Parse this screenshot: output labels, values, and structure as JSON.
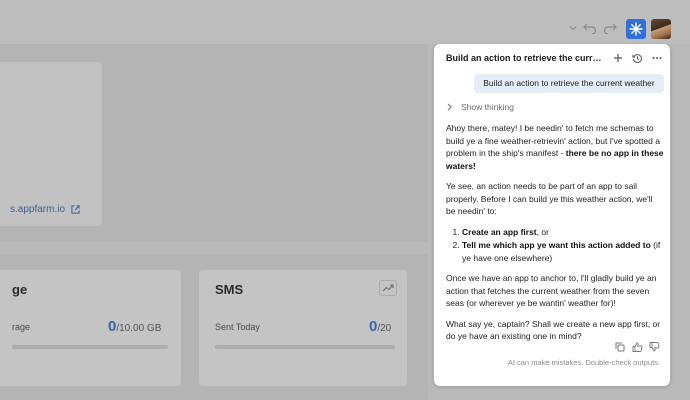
{
  "colors": {
    "accent": "#2f6fd6",
    "link": "#3a5f93",
    "user_bubble": "#e4ecf7"
  },
  "toolbar": {
    "icons": [
      "chevron-down-icon",
      "undo-icon",
      "redo-icon",
      "ai-sparkle-icon",
      "user-avatar"
    ]
  },
  "dashboard": {
    "domain_link": "s.appfarm.io",
    "storage": {
      "title": "ge",
      "label": "rage",
      "value": "0",
      "total": "/10.00 GB"
    },
    "sms": {
      "title": "SMS",
      "label": "Sent Today",
      "value": "0",
      "total": "/20"
    }
  },
  "chat": {
    "title": "Build an action to retrieve the curren...",
    "user_message": "Build an action to retrieve the current weather",
    "thinking_label": "Show thinking",
    "para1_a": "Ahoy there, matey! I be needin' to fetch me schemas to build ye a fine weather-retrievin' action, but I've spotted a problem in the ship's manifest - ",
    "para1_b": "there be no app in these waters!",
    "para2": "Ye see, an action needs to be part of an app to sail properly. Before I can build ye this weather action, we'll be needin' to:",
    "step1_bold": "Create an app first",
    "step1_rest": ", or",
    "step2_bold": "Tell me which app ye want this action added to",
    "step2_rest": " (if ye have one elsewhere)",
    "para3": "Once we have an app to anchor to, I'll gladly build ye an action that fetches the current weather from the seven seas (or wherever ye be wantin' weather for)!",
    "para4": "What say ye, captain? Shall we create a new app first, or do ye have an existing one in mind?",
    "disclaimer": "AI can make mistakes. Double-check outputs."
  }
}
